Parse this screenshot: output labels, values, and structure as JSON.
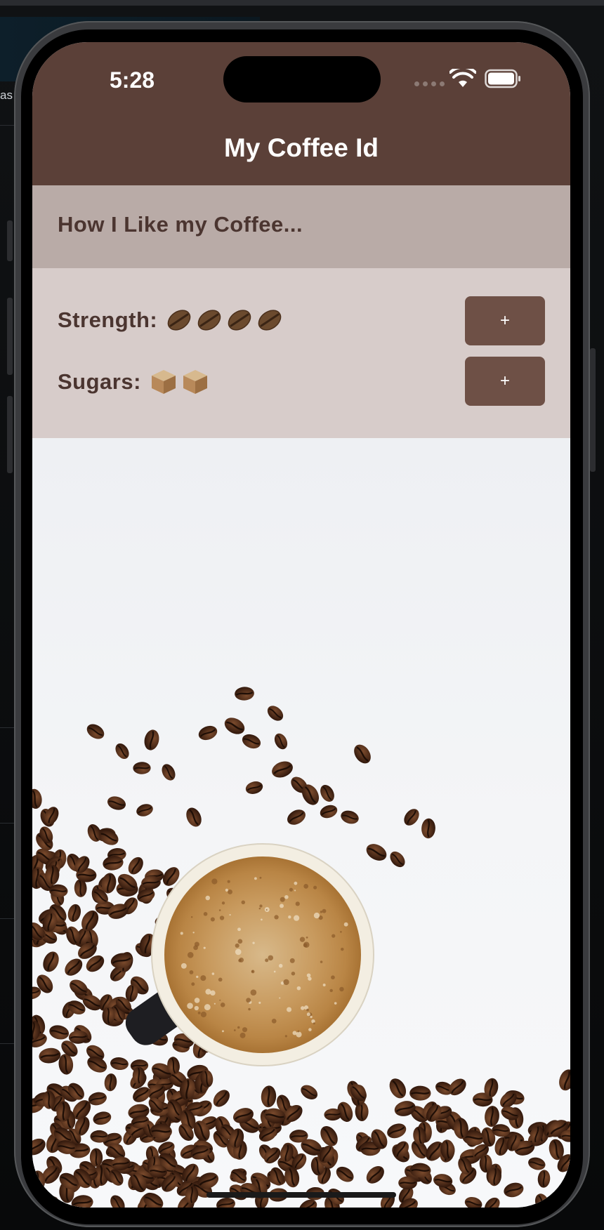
{
  "status_bar": {
    "time": "5:28"
  },
  "app": {
    "title": "My Coffee Id"
  },
  "section": {
    "title": "How I Like my Coffee..."
  },
  "preferences": {
    "strength": {
      "label": "Strength:",
      "count": 4,
      "icon": "coffee-bean-icon"
    },
    "sugars": {
      "label": "Sugars:",
      "count": 2,
      "icon": "sugar-cube-icon"
    }
  },
  "buttons": {
    "strength_increment": "+",
    "sugars_increment": "+"
  },
  "desktop": {
    "side_text": "as"
  },
  "colors": {
    "header": "#5b4038",
    "section_header": "#b9aba7",
    "settings_bg": "#d7ccca",
    "button": "#6e5046",
    "text_dark": "#4b3530"
  }
}
